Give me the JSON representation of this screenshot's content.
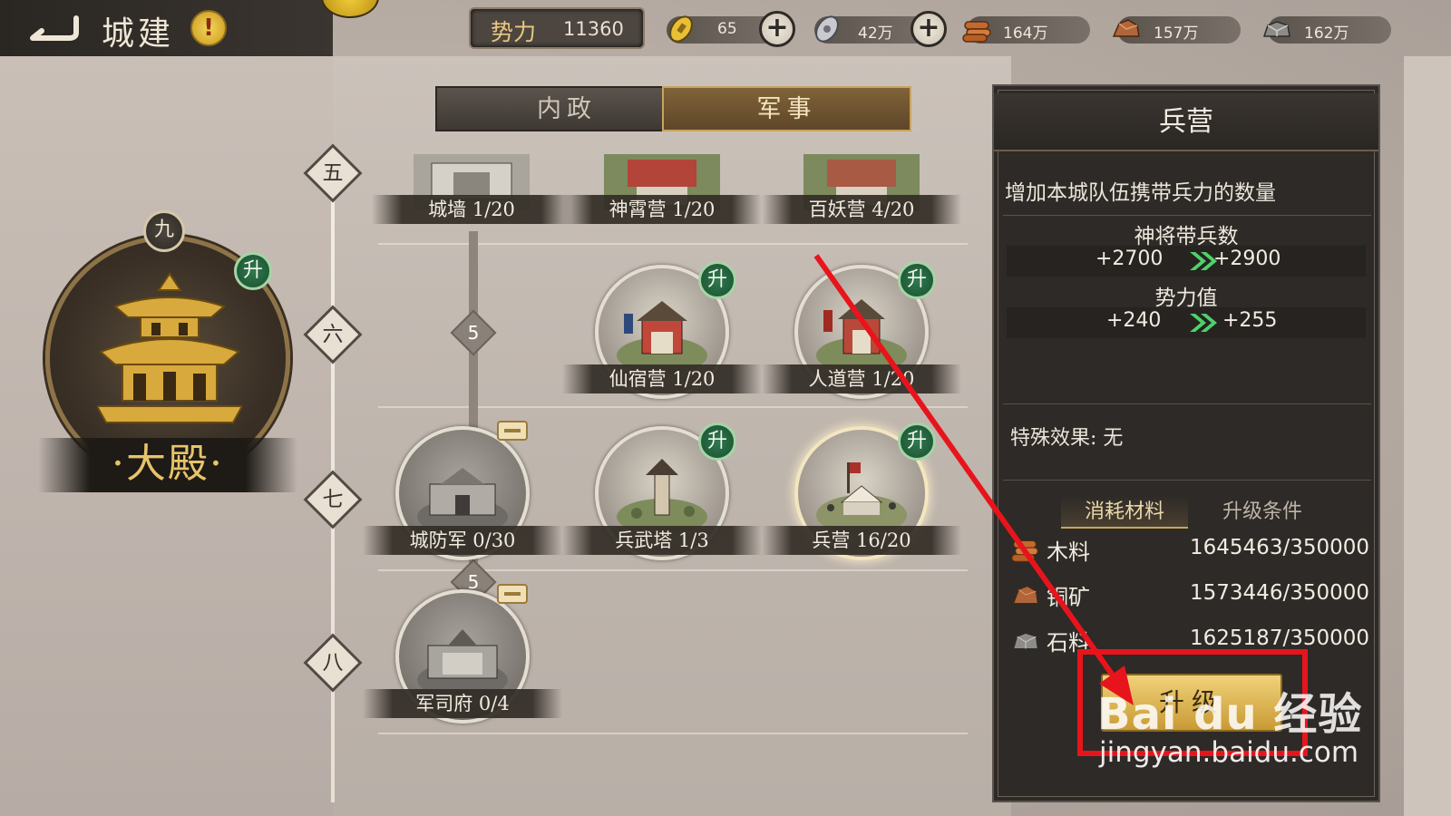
{
  "header": {
    "title": "城建",
    "alert": "!",
    "power_label": "势力",
    "power_value": "11360"
  },
  "resources": [
    {
      "name": "gold-coin",
      "value": "65"
    },
    {
      "name": "silver",
      "value": "42万"
    },
    {
      "name": "wood",
      "value": "164万"
    },
    {
      "name": "copper",
      "value": "157万"
    },
    {
      "name": "stone",
      "value": "162万"
    }
  ],
  "tabs": {
    "civil": "内政",
    "military": "军事"
  },
  "palace": {
    "level": "九",
    "name": "·大殿·",
    "upgrade": "升"
  },
  "tiers": [
    "五",
    "六",
    "七",
    "八"
  ],
  "connectors": [
    "5",
    "5"
  ],
  "buildings": {
    "wall": "城墙 1/20",
    "shenxiao": "神霄营 1/20",
    "baiyao": "百妖营 4/20",
    "xiansu": "仙宿营 1/20",
    "rendao": "人道营 1/20",
    "chengfang": "城防军 0/30",
    "bingwu": "兵武塔 1/3",
    "bingying": "兵营 16/20",
    "junsi": "军司府 0/4"
  },
  "upgrade_badge": "升",
  "info": {
    "title": "兵营",
    "desc": "增加本城队伍携带兵力的数量",
    "stat1_name": "神将带兵数",
    "stat1_from": "+2700",
    "stat1_to": "+2900",
    "stat2_name": "势力值",
    "stat2_from": "+240",
    "stat2_to": "+255",
    "special": "特殊效果:  无",
    "tab_materials": "消耗材料",
    "tab_conditions": "升级条件",
    "materials": [
      {
        "name": "木料",
        "value": "1645463/350000"
      },
      {
        "name": "铜矿",
        "value": "1573446/350000"
      },
      {
        "name": "石料",
        "value": "1625187/350000"
      }
    ],
    "upgrade_button": "升级"
  },
  "watermark": {
    "brand": "Bai du 经验",
    "url": "jingyan.baidu.com"
  },
  "colors": {
    "accent_gold": "#c99a34",
    "upgrade_green": "#2f7a4e",
    "highlight_red": "#e8141c"
  }
}
